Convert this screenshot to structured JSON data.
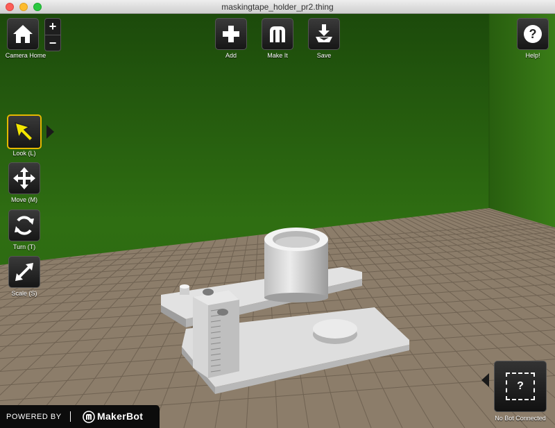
{
  "window": {
    "title": "maskingtape_holder_pr2.thing"
  },
  "toolbar": {
    "camera_home": "Camera Home",
    "zoom_in": "+",
    "zoom_out": "−",
    "add": "Add",
    "make_it": "Make It",
    "save": "Save",
    "help": "Help!"
  },
  "tools": [
    {
      "label": "Look (L)",
      "icon": "cursor-arrow-icon",
      "selected": true
    },
    {
      "label": "Move (M)",
      "icon": "move-arrows-icon",
      "selected": false
    },
    {
      "label": "Turn (T)",
      "icon": "rotate-icon",
      "selected": false
    },
    {
      "label": "Scale (S)",
      "icon": "scale-arrow-icon",
      "selected": false
    }
  ],
  "bot": {
    "label": "No Bot Connected",
    "glyph": "?"
  },
  "footer": {
    "powered_by": "POWERED BY",
    "brand": "MakerBot"
  },
  "colors": {
    "background_green": "#2f6e12",
    "platform": "#8c7d6a",
    "selection": "#e6b800",
    "look_cursor": "#f3e600",
    "model": "#d9d9d9"
  }
}
